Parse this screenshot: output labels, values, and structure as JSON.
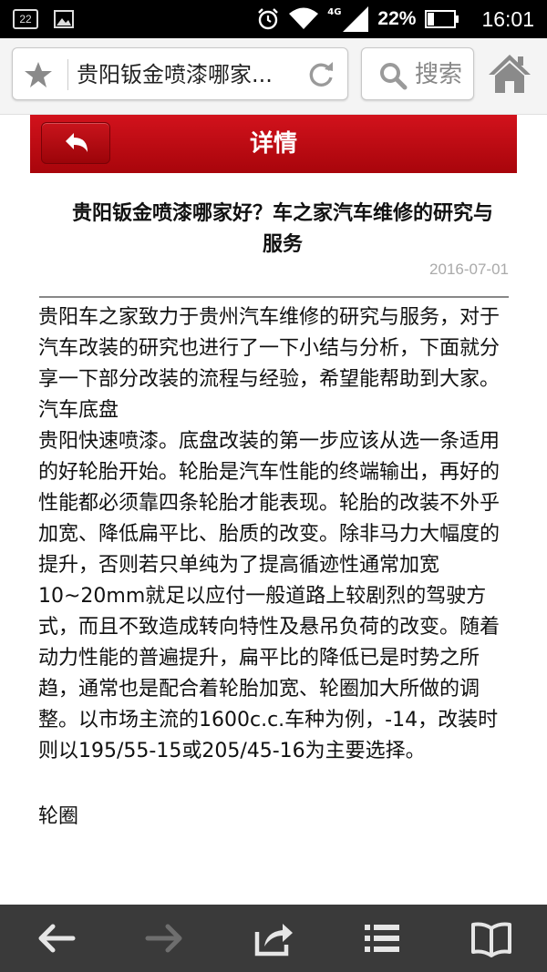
{
  "status_bar": {
    "notification_count": "22",
    "network_type": "4G",
    "battery_percent": "22%",
    "time": "16:01"
  },
  "browser": {
    "url_title": "贵阳钣金喷漆哪家...",
    "search_label": "搜索"
  },
  "header": {
    "title": "详情"
  },
  "article": {
    "title_line1": "贵阳钣金喷漆哪家好？车之家汽车维修的研究与",
    "title_line2": "服务",
    "date": "2016-07-01",
    "paragraphs": [
      "贵阳车之家致力于贵州汽车维修的研究与服务，对于汽车改装的研究也进行了一下小结与分析，下面就分享一下部分改装的流程与经验，希望能帮助到大家。",
      "汽车底盘",
      "贵阳快速喷漆。底盘改装的第一步应该从选一条适用的好轮胎开始。轮胎是汽车性能的终端输出，再好的性能都必须靠四条轮胎才能表现。轮胎的改装不外乎加宽、降低扁平比、胎质的改变。除非马力大幅度的提升，否则若只单纯为了提高循迹性通常加宽10~20mm就足以应付一般道路上较剧烈的驾驶方式，而且不致造成转向特性及悬吊负荷的改变。随着动力性能的普遍提升，扁平比的降低已是时势之所趋，通常也是配合着轮胎加宽、轮圈加大所做的调整。以市场主流的1600c.c.车种为例，-14，改装时则以195/55-15或205/45-16为主要选择。",
      "轮圈"
    ]
  },
  "colors": {
    "header_red": "#c00d15",
    "status_bar_bg": "#000000",
    "bottom_nav_bg": "#3a3a3a"
  }
}
